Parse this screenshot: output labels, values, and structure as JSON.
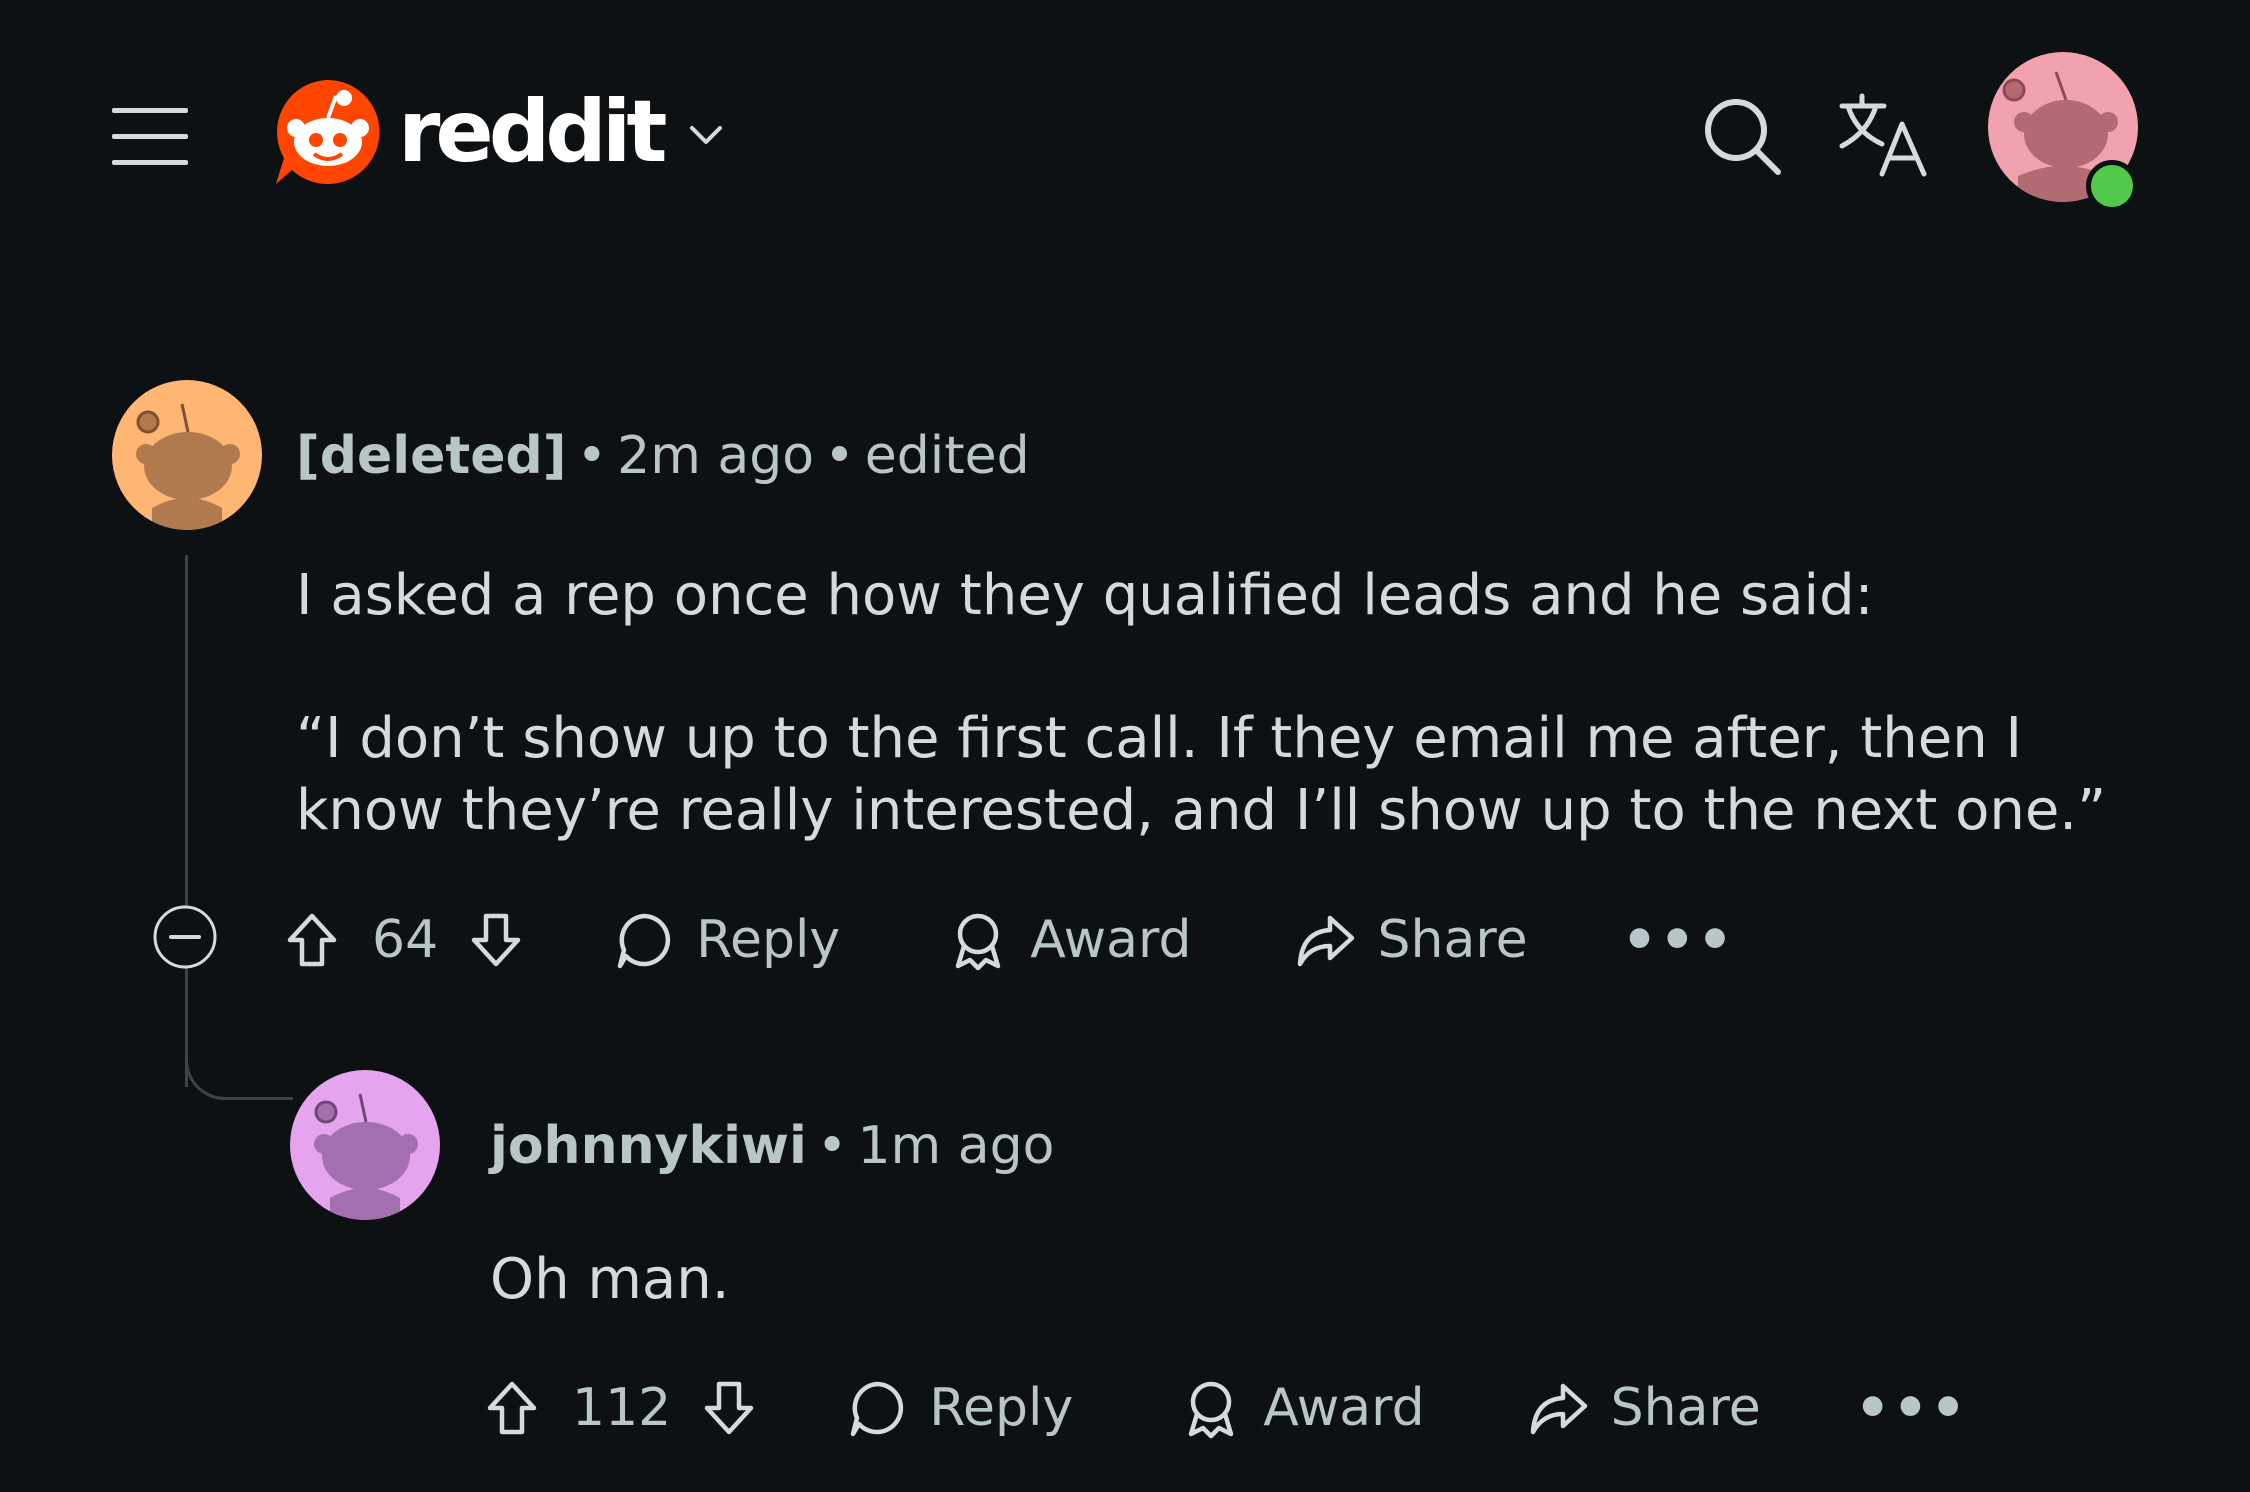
{
  "header": {
    "logo_text": "reddit",
    "icons": [
      "menu-icon",
      "reddit-snoo-logo",
      "chevron-down-icon",
      "search-icon",
      "translate-icon",
      "user-avatar"
    ],
    "colors": {
      "background": "#0e1113",
      "brand": "#ff4500",
      "online": "#52c94a"
    }
  },
  "comments": [
    {
      "author": "[deleted]",
      "time": "2m ago",
      "edited": "edited",
      "body_line1": "I asked a rep once how they qualified leads and he said:",
      "body_quote": "“I don’t show up to the first call. If they email me after, then I know they’re really interested, and I’ll show up to the next one.”",
      "votes": "64",
      "reply": "Reply",
      "award": "Award",
      "share": "Share",
      "more": "•••",
      "avatar_color": "#ffb673"
    },
    {
      "author": "johnnykiwi",
      "time": "1m ago",
      "body": "Oh man.",
      "votes": "112",
      "reply": "Reply",
      "award": "Award",
      "share": "Share",
      "more": "•••",
      "avatar_color": "#e5a4ee"
    }
  ],
  "separator": "•"
}
